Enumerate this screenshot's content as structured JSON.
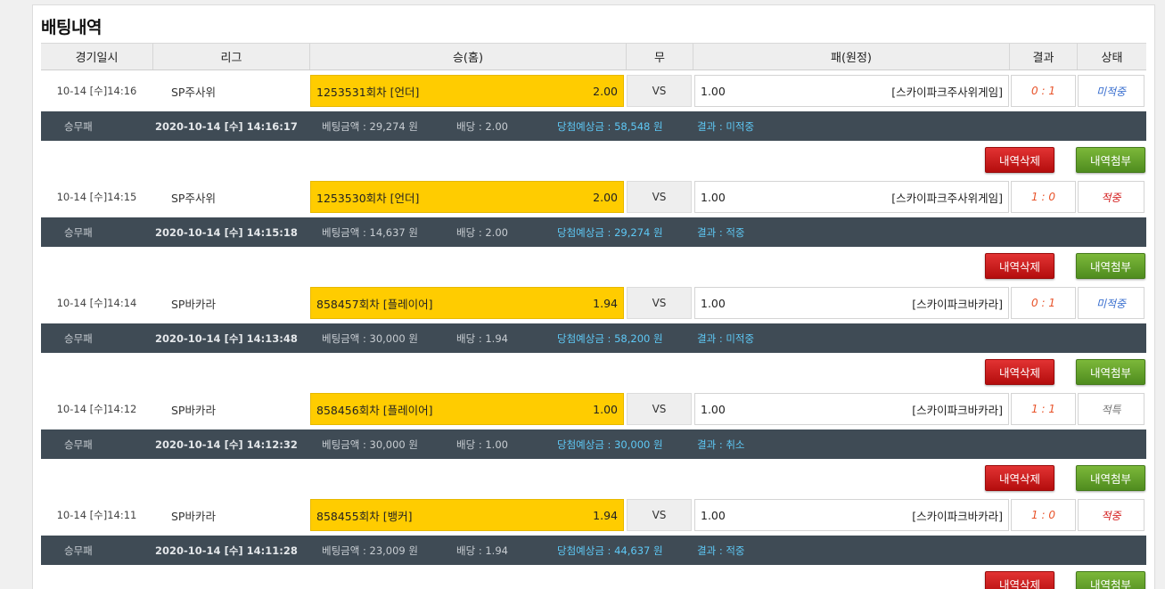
{
  "page_title": "배팅내역",
  "headers": [
    "경기일시",
    "리그",
    "승(홈)",
    "무",
    "패(원정)",
    "결과",
    "상태"
  ],
  "delete_label": "내역삭제",
  "attach_label": "내역첨부",
  "bets": [
    {
      "date": "10-14 [수]14:16",
      "league": "SP주사위",
      "home_team": "1253531회차 [언더]",
      "home_odds": "2.00",
      "draw": "VS",
      "away_odds": "1.00",
      "away_team": "[스카이파크주사위게임]",
      "score": "0 : 1",
      "state": "미적중",
      "state_kind": "pending",
      "type": "승무패",
      "bet_time": "2020-10-14 [수] 14:16:17",
      "amount": "베팅금액 : 29,274 원",
      "odds": "배당 : 2.00",
      "expected": "당첨예상금 : 58,548 원",
      "result": "결과 : 미적중"
    },
    {
      "date": "10-14 [수]14:15",
      "league": "SP주사위",
      "home_team": "1253530회차 [언더]",
      "home_odds": "2.00",
      "draw": "VS",
      "away_odds": "1.00",
      "away_team": "[스카이파크주사위게임]",
      "score": "1 : 0",
      "state": "적중",
      "state_kind": "win",
      "type": "승무패",
      "bet_time": "2020-10-14 [수] 14:15:18",
      "amount": "베팅금액 : 14,637 원",
      "odds": "배당 : 2.00",
      "expected": "당첨예상금 : 29,274 원",
      "result": "결과 : 적중"
    },
    {
      "date": "10-14 [수]14:14",
      "league": "SP바카라",
      "home_team": "858457회차 [플레이어]",
      "home_odds": "1.94",
      "draw": "VS",
      "away_odds": "1.00",
      "away_team": "[스카이파크바카라]",
      "score": "0 : 1",
      "state": "미적중",
      "state_kind": "pending",
      "type": "승무패",
      "bet_time": "2020-10-14 [수] 14:13:48",
      "amount": "베팅금액 : 30,000 원",
      "odds": "배당 : 1.94",
      "expected": "당첨예상금 : 58,200 원",
      "result": "결과 : 미적중"
    },
    {
      "date": "10-14 [수]14:12",
      "league": "SP바카라",
      "home_team": "858456회차 [플레이어]",
      "home_odds": "1.00",
      "draw": "VS",
      "away_odds": "1.00",
      "away_team": "[스카이파크바카라]",
      "score": "1 : 1",
      "state": "적특",
      "state_kind": "cancel",
      "type": "승무패",
      "bet_time": "2020-10-14 [수] 14:12:32",
      "amount": "베팅금액 : 30,000 원",
      "odds": "배당 : 1.00",
      "expected": "당첨예상금 : 30,000 원",
      "result": "결과 : 취소"
    },
    {
      "date": "10-14 [수]14:11",
      "league": "SP바카라",
      "home_team": "858455회차 [뱅커]",
      "home_odds": "1.94",
      "draw": "VS",
      "away_odds": "1.00",
      "away_team": "[스카이파크바카라]",
      "score": "1 : 0",
      "state": "적중",
      "state_kind": "win",
      "type": "승무패",
      "bet_time": "2020-10-14 [수] 14:11:28",
      "amount": "베팅금액 : 23,009 원",
      "odds": "배당 : 1.94",
      "expected": "당첨예상금 : 44,637 원",
      "result": "결과 : 적중"
    }
  ]
}
